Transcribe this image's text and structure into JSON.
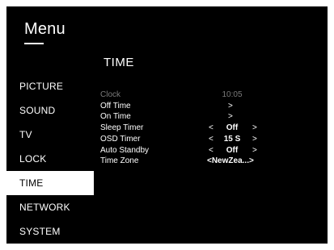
{
  "menu": {
    "title": "Menu"
  },
  "sidebar": {
    "items": [
      {
        "label": "PICTURE"
      },
      {
        "label": "SOUND"
      },
      {
        "label": "TV"
      },
      {
        "label": "LOCK"
      },
      {
        "label": "TIME"
      },
      {
        "label": "NETWORK"
      },
      {
        "label": "SYSTEM"
      }
    ],
    "active": "TIME"
  },
  "panel": {
    "title": "TIME",
    "rows": {
      "clock": {
        "label": "Clock",
        "value": "10:05"
      },
      "off_time": {
        "label": "Off Time",
        "arrow": ">"
      },
      "on_time": {
        "label": "On Time",
        "arrow": ">"
      },
      "sleep_timer": {
        "label": "Sleep Timer",
        "left": "<",
        "value": "Off",
        "right": ">"
      },
      "osd_timer": {
        "label": "OSD Timer",
        "left": "<",
        "value": "15 S",
        "right": ">"
      },
      "auto_standby": {
        "label": "Auto Standby",
        "left": "<",
        "value": "Off",
        "right": ">"
      },
      "time_zone": {
        "label": "Time Zone",
        "value": "<NewZea...>"
      }
    }
  },
  "colors": {
    "screen_bg": "#000000",
    "text": "#ffffff",
    "disabled_text": "#7a7a7a",
    "selected_bg": "#ffffff",
    "selected_text": "#000000"
  }
}
